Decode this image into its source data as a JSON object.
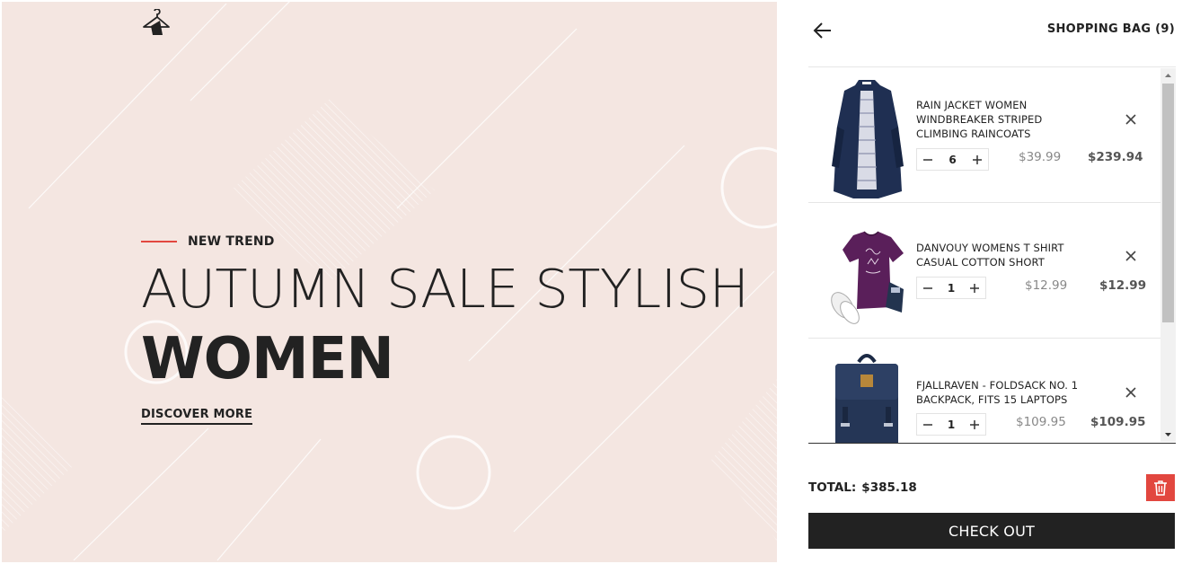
{
  "hero": {
    "eyebrow": "NEW TREND",
    "headline": "AUTUMN SALE STYLISH",
    "headline_bold": "WOMEN",
    "cta": "DISCOVER MORE",
    "background_color": "#f4e6e1",
    "accent_color": "#e2473f"
  },
  "cart": {
    "title": "SHOPPING BAG (9)",
    "back_icon": "arrow-left-icon",
    "items": [
      {
        "name": "RAIN JACKET WOMEN WINDBREAKER STRIPED CLIMBING RAINCOATS",
        "quantity": "6",
        "unit_price": "$39.99",
        "subtotal": "$239.94",
        "image": "navy-rain-jacket"
      },
      {
        "name": "DANVOUY WOMENS T SHIRT CASUAL COTTON SHORT",
        "quantity": "1",
        "unit_price": "$12.99",
        "subtotal": "$12.99",
        "image": "purple-tshirt"
      },
      {
        "name": "FJALLRAVEN - FOLDSACK NO. 1 BACKPACK, FITS 15 LAPTOPS",
        "quantity": "1",
        "unit_price": "$109.95",
        "subtotal": "$109.95",
        "image": "navy-backpack"
      }
    ],
    "total_label": "TOTAL:",
    "total_value": "$385.18",
    "checkout_label": "CHECK OUT",
    "clear_icon": "trash-icon",
    "clear_color": "#e2473f"
  }
}
